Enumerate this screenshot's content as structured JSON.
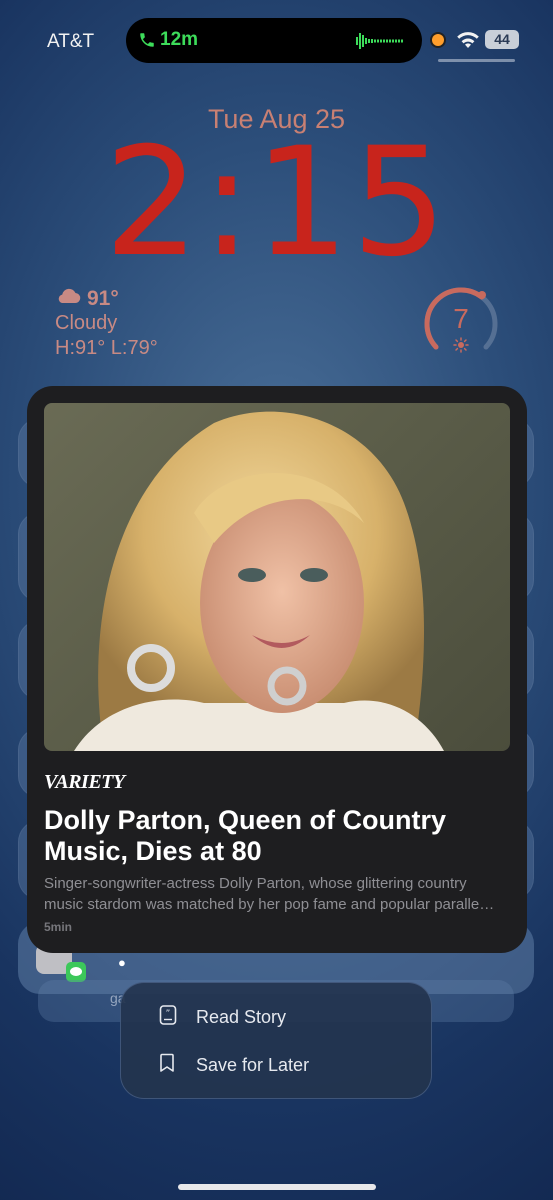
{
  "status_bar": {
    "carrier": "AT&T",
    "call_duration": "12m",
    "battery_level": "44",
    "call_color": "#3ddc5a",
    "recording_indicator_color": "#ff9e2c"
  },
  "lock_screen": {
    "date": "Tue Aug 25",
    "time": "2:15",
    "time_color": "#c8241c",
    "weather": {
      "icon": "cloud-icon",
      "temperature": "91°",
      "condition": "Cloudy",
      "high_low": "H:91° L:79°"
    },
    "uv_index": {
      "value": "7",
      "icon": "sun-icon",
      "level_fraction": 0.64
    }
  },
  "news_card": {
    "publisher": "VARIETY",
    "headline": "Dolly Parton, Queen of Country Music, Dies at 80",
    "summary_line1": "Singer-songwriter-actress Dolly Parton, whose glittering country",
    "summary_line2": "music stardom was matched by her pop fame and popular paralle…",
    "age": "5min"
  },
  "background_notification": {
    "app_icon": "messages-icon",
    "preview_fragment": "ga"
  },
  "context_menu": {
    "items": [
      {
        "label": "Read Story",
        "icon": "quote-doc-icon"
      },
      {
        "label": "Save for Later",
        "icon": "bookmark-icon"
      }
    ]
  }
}
